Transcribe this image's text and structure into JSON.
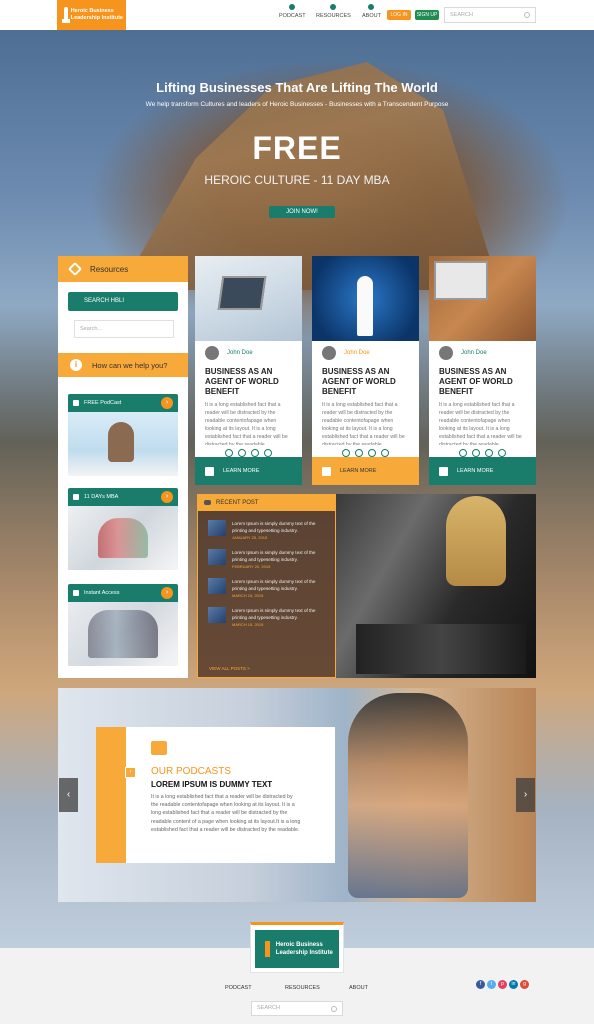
{
  "header": {
    "logo_text": "Heroic Business Leadership Institute",
    "nav": [
      "PODCAST",
      "RESOURCES",
      "ABOUT"
    ],
    "login_label": "LOG IN",
    "signup_label": "SIGN UP",
    "search_placeholder": "SEARCH"
  },
  "hero": {
    "title": "Lifting Businesses That Are Lifting The World",
    "subtitle": "We help transform Cultures and leaders of Heroic Businesses - Businesses with a Transcendent Purpose",
    "headline": "FREE",
    "program": "HEROIC CULTURE - 11 DAY MBA",
    "cta": "JOIN NOW!"
  },
  "sidebar": {
    "title": "Resources",
    "search_button": "SEARCH HBLI",
    "search_placeholder": "Search...",
    "help_title": "How can we help you?",
    "cards": [
      {
        "label": "FREE PodCast"
      },
      {
        "label": "11 DAYs MBA"
      },
      {
        "label": "Instant Access"
      }
    ]
  },
  "articles": [
    {
      "author": "John Doe",
      "title": "BUSINESS AS AN AGENT OF WORLD BENEFIT",
      "body": "It is a long established fact that a reader will be distracted by the readable contentofapage when looking at its layout. It is a long established fact that a reader will be distracted by the readable",
      "more": "LEARN MORE"
    },
    {
      "author": "John Doe",
      "title": "BUSINESS AS AN AGENT OF WORLD BENEFIT",
      "body": "It is a long established fact that a reader will be distracted by the readable contentofapage when looking at its layout. It is a long established fact that a reader will be distracted by the readable",
      "more": "LEARN MORE"
    },
    {
      "author": "John Doe",
      "title": "BUSINESS AS AN AGENT OF WORLD BENEFIT",
      "body": "It is a long established fact that a reader will be distracted by the readable contentofapage when looking at its layout. It is a long established fact that a reader will be distracted by the readable",
      "more": "LEARN MORE"
    }
  ],
  "recent": {
    "title": "RECENT POST",
    "posts": [
      {
        "text": "Lorem Ipsum is simply dummy text of the printing and typesetting industry.",
        "date": "JANUARY 25, 2015"
      },
      {
        "text": "Lorem Ipsum is simply dummy text of the printing and typesetting industry.",
        "date": "FEBRUARY 20, 2015"
      },
      {
        "text": "Lorem Ipsum is simply dummy text of the printing and typesetting industry.",
        "date": "MARCH 15, 2015"
      },
      {
        "text": "Lorem Ipsum is simply dummy text of the printing and typesetting industry.",
        "date": "MARCH 15, 2015"
      }
    ],
    "view_all": "VIEW ALL POSTS >"
  },
  "podcast": {
    "label": "OUR PODCASTS",
    "heading": "LOREM IPSUM IS DUMMY TEXT",
    "body": "It is a long established fact that a reader will be distracted by the readable contentofapage when looking at its layout. It is a long established fact that a reader will be distracted by the readable content of a page when looking at its layout.It is a long established fact that a reader will be distracted by the readable."
  },
  "footer": {
    "logo_text": "Heroic Business Leadership Institute",
    "nav": [
      "PODCAST",
      "RESOURCES",
      "ABOUT"
    ],
    "search_placeholder": "SEARCH",
    "social": [
      "f",
      "t",
      "p",
      "in",
      "g"
    ]
  },
  "colors": {
    "brand_orange": "#f7941d",
    "brand_green": "#1a7d6b",
    "social": [
      "#3b5998",
      "#55acee",
      "#e4405f",
      "#0077b5",
      "#dd4b39"
    ]
  }
}
